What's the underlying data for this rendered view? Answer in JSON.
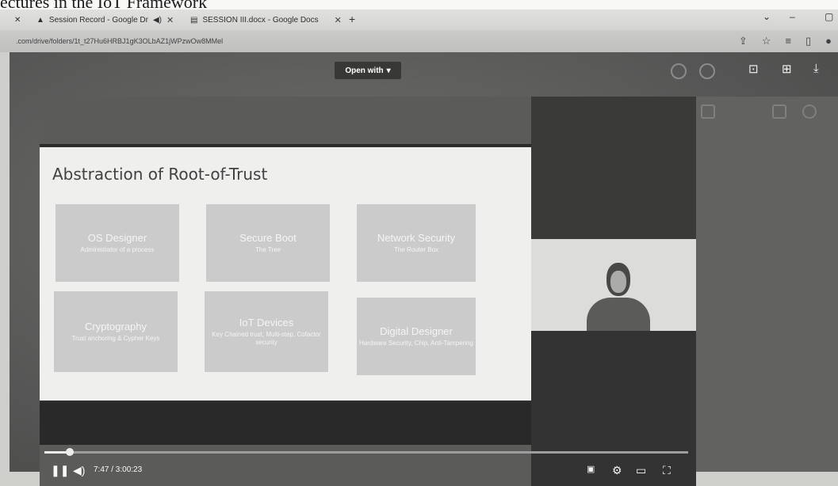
{
  "page_heading": "ectures in the IoT Framework",
  "tabs": [
    {
      "label": "Session Record - Google Dr",
      "icon": "drive-icon"
    },
    {
      "label": "SESSION III.docx - Google Docs",
      "icon": "docs-icon"
    }
  ],
  "url": ".com/drive/folders/1t_t27Hu6HRBJ1gK3OLbAZ1jWPzwOw8MMel",
  "viewer": {
    "open_with_label": "Open with"
  },
  "slide": {
    "title": "Abstraction of Root-of-Trust",
    "cards": [
      {
        "title": "OS Designer",
        "subtitle": "Administrator of a process"
      },
      {
        "title": "Secure Boot",
        "subtitle": "The Tree"
      },
      {
        "title": "Network Security",
        "subtitle": "The Router Box"
      },
      {
        "title": "Cryptography",
        "subtitle": "Trust anchoring & Cypher Keys"
      },
      {
        "title": "IoT Devices",
        "subtitle": "Key Chained trust, Multi-step, Cofactor security"
      },
      {
        "title": "Digital Designer",
        "subtitle": "Hardware Security, Chip, Anti-Tampering"
      }
    ]
  },
  "video": {
    "time": "7:47 / 3:00:23",
    "progress": 0.04
  }
}
